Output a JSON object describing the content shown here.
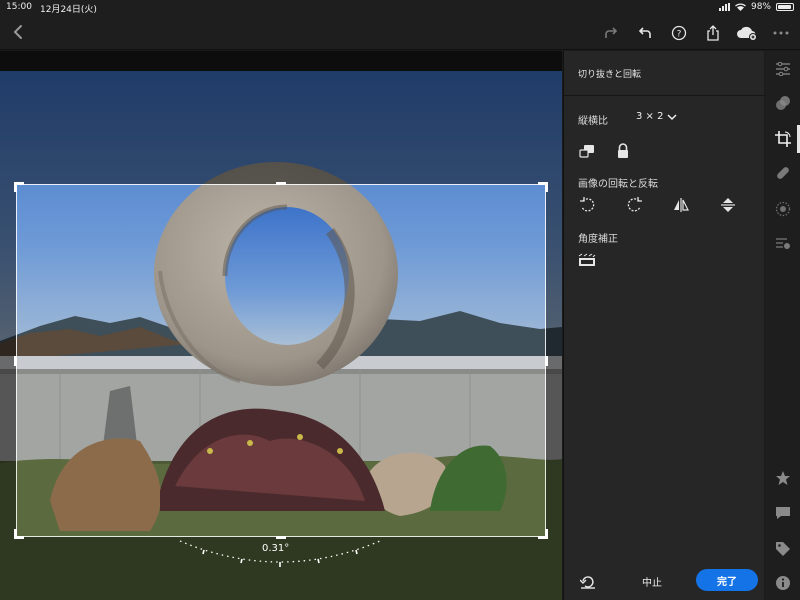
{
  "status_bar": {
    "time": "15:00",
    "date": "12月24日(火)",
    "battery_percent": "98%"
  },
  "toolbar": {
    "icons": [
      "back-icon",
      "redo-icon",
      "undo-icon",
      "help-icon",
      "share-icon",
      "cloud-sync-icon",
      "more-icon"
    ]
  },
  "photo": {
    "angle_readout": "0.31°"
  },
  "panel": {
    "title": "切り抜きと回転",
    "aspect_label": "縦横比",
    "aspect_value": "3 × 2",
    "rotate_flip_label": "画像の回転と反転",
    "straighten_label": "角度補正",
    "cancel_label": "中止",
    "done_label": "完了"
  },
  "rail": {
    "icons": [
      "edit-sliders-icon",
      "presets-icon",
      "crop-icon",
      "healing-icon",
      "selective-icon",
      "versions-icon",
      "star-icon",
      "comment-icon",
      "tag-icon",
      "info-icon"
    ],
    "active": "crop-icon"
  },
  "colors": {
    "accent": "#1473e6",
    "panel_bg": "#262626",
    "app_bg": "#1b1b1b"
  }
}
